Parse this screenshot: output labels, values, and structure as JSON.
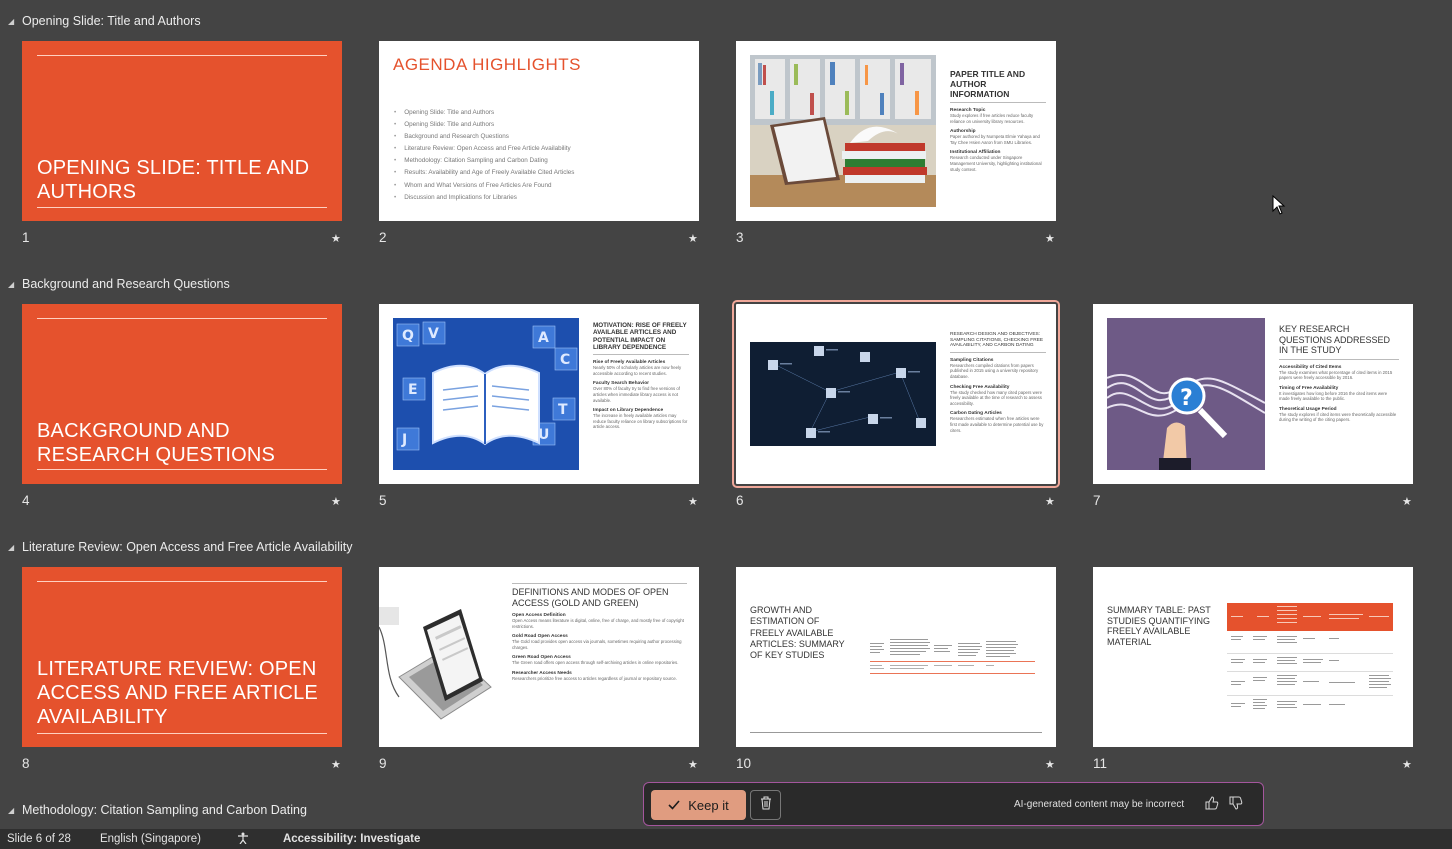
{
  "sections": [
    {
      "label": "Opening Slide: Title and Authors"
    },
    {
      "label": "Background and Research Questions"
    },
    {
      "label": "Literature Review: Open Access and Free Article Availability"
    },
    {
      "label": "Methodology: Citation Sampling and Carbon Dating"
    }
  ],
  "slides": {
    "s1": {
      "num": "1",
      "title": "OPENING SLIDE: TITLE AND AUTHORS"
    },
    "s2": {
      "num": "2",
      "title": "AGENDA HIGHLIGHTS",
      "items": [
        "Opening Slide: Title and Authors",
        "Opening Slide: Title and Authors",
        "Background and Research Questions",
        "Literature Review: Open Access and Free Article Availability",
        "Methodology: Citation Sampling and Carbon Dating",
        "Results: Availability and Age of Freely Available Cited Articles",
        "Whom and What Versions of Free Articles Are Found",
        "Discussion and Implications for Libraries"
      ]
    },
    "s3": {
      "num": "3",
      "title": "PAPER TITLE AND AUTHOR INFORMATION",
      "h1": "Research Topic",
      "b1": "Study explores if free articles reduce faculty reliance on university library resources.",
      "h2": "Authorship",
      "b2": "Paper authored by Nurnpeta Elmie Yahaya and Tay Chee Hsien Aaron from SMU Libraries.",
      "h3": "Institutional Affiliation",
      "b3": "Research conducted under Singapore Management University, highlighting institutional study context."
    },
    "s4": {
      "num": "4",
      "title": "BACKGROUND AND RESEARCH QUESTIONS"
    },
    "s5": {
      "num": "5",
      "title": "MOTIVATION: RISE OF FREELY AVAILABLE ARTICLES AND POTENTIAL IMPACT ON LIBRARY DEPENDENCE",
      "h1": "Rise of Freely Available Articles",
      "b1": "Nearly 50% of scholarly articles are now freely accessible according to recent studies.",
      "h2": "Faculty Search Behavior",
      "b2": "Over 80% of faculty try to find free versions of articles when immediate library access is not available.",
      "h3": "Impact on Library Dependence",
      "b3": "The increase in freely available articles may reduce faculty reliance on library subscriptions for article access."
    },
    "s6": {
      "num": "6",
      "title": "RESEARCH DESIGN AND OBJECTIVES: SAMPLING CITATIONS, CHECKING FREE AVAILABILITY, AND CARBON DATING",
      "h1": "Sampling Citations",
      "b1": "Researchers compiled citations from papers published in 2015 using a university repository database.",
      "h2": "Checking Free Availability",
      "b2": "The study checked how many cited papers were freely available at the time of research to assess accessibility.",
      "h3": "Carbon Dating Articles",
      "b3": "Researchers estimated when free articles were first made available to determine potential use by citers."
    },
    "s7": {
      "num": "7",
      "title": "KEY RESEARCH QUESTIONS ADDRESSED IN THE STUDY",
      "h1": "Accessibility of Cited Items",
      "b1": "The study examines what percentage of cited items in 2015 papers were freely accessible by 2016.",
      "h2": "Timing of Free Availability",
      "b2": "It investigates how long before 2016 the cited items were made freely available to the public.",
      "h3": "Theoretical Usage Period",
      "b3": "The study explores if cited items were theoretically accessible during the writing of the citing papers."
    },
    "s8": {
      "num": "8",
      "title": "LITERATURE REVIEW: OPEN ACCESS AND FREE ARTICLE AVAILABILITY"
    },
    "s9": {
      "num": "9",
      "title": "DEFINITIONS AND MODES OF OPEN ACCESS (GOLD AND GREEN)",
      "h1": "Open Access Definition",
      "b1": "Open Access means literature is digital, online, free of charge, and mostly free of copyright restrictions.",
      "h2": "Gold Road Open Access",
      "b2": "The Gold road provides open access via journals, sometimes requiring author processing charges.",
      "h3": "Green Road Open Access",
      "b3": "The Green road offers open access through self-archiving articles in online repositories.",
      "h4": "Researcher Access Needs",
      "b4": "Researchers prioritize free access to articles regardless of journal or repository source."
    },
    "s10": {
      "num": "10",
      "title": "GROWTH AND ESTIMATION OF FREELY AVAILABLE ARTICLES: SUMMARY OF KEY STUDIES"
    },
    "s11": {
      "num": "11",
      "title": "SUMMARY TABLE: PAST STUDIES QUANTIFYING FREELY AVAILABLE MATERIAL"
    }
  },
  "star_glyph": "★",
  "ai_bar": {
    "keep_label": "Keep it",
    "note": "AI-generated content may be incorrect"
  },
  "status": {
    "slide": "Slide 6 of 28",
    "language": "English (Singapore)",
    "accessibility": "Accessibility: Investigate"
  },
  "colors": {
    "accent": "#e5522d",
    "background": "#444444",
    "selected": "#f0a89a"
  }
}
